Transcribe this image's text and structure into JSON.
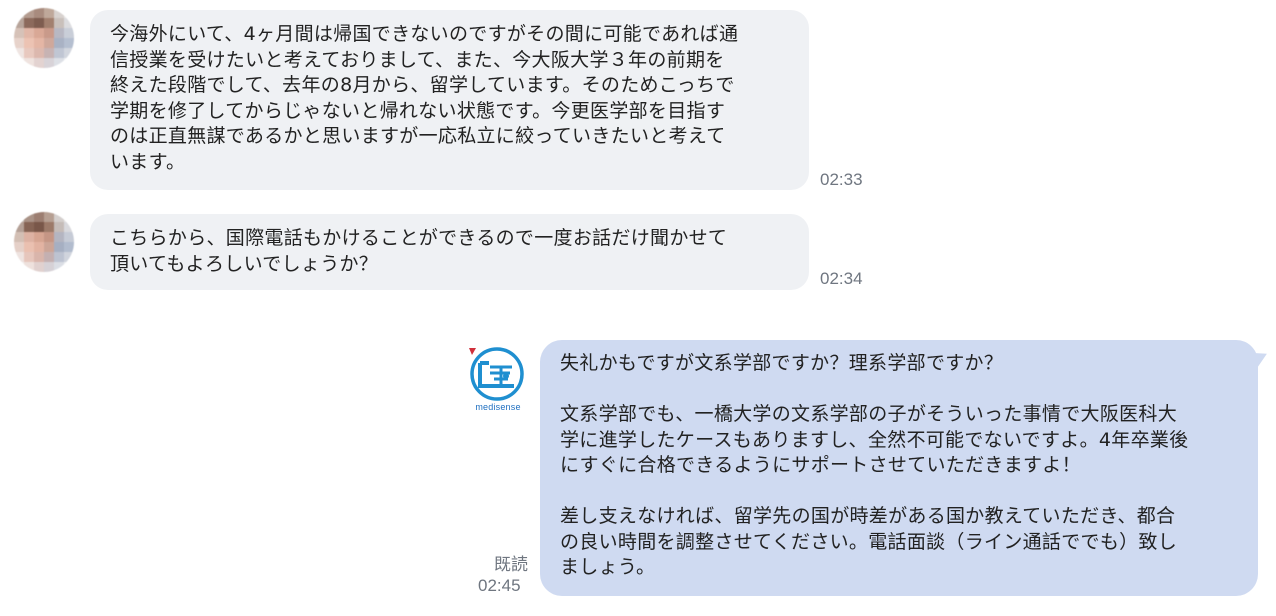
{
  "messages": [
    {
      "id": 1,
      "side": "incoming",
      "lines": [
        "今海外にいて、4ヶ月間は帰国できないのですがその間に可能であれば通",
        "信授業を受けたいと考えておりまして、また、今大阪大学３年の前期を",
        "終えた段階でして、去年の8月から、留学しています。そのためこっちで",
        "学期を修了してからじゃないと帰れない状態です。今更医学部を目指す",
        "のは正直無謀であるかと思いますが一応私立に絞っていきたいと考えて",
        "います。"
      ],
      "time": "02:33"
    },
    {
      "id": 2,
      "side": "incoming",
      "lines": [
        "こちらから、国際電話もかけることができるので一度お話だけ聞かせて",
        "頂いてもよろしいでしょうか？"
      ],
      "time": "02:34"
    },
    {
      "id": 3,
      "side": "outgoing",
      "lines": [
        "失礼かもですが文系学部ですか？理系学部ですか？",
        "",
        "文系学部でも、一橋大学の文系学部の子がそういった事情で大阪医科大",
        "学に進学したケースもありますし、全然不可能でないですよ。4年卒業後",
        "にすぐに合格できるようにサポートさせていただきますよ！",
        "",
        "差し支えなければ、留学先の国が時差がある国か教えていただき、都合",
        "の良い時間を調整させてください。電話面談（ライン通話ででも）致し",
        "ましょう。"
      ],
      "read_label": "既読",
      "time": "02:45"
    }
  ],
  "sender_logo": {
    "text": "medisense",
    "icon": "medisense-logo-icon"
  },
  "colors": {
    "incoming_bubble": "#eff1f4",
    "outgoing_bubble": "#cfdaf1",
    "timestamp": "#6f7680",
    "logo_blue": "#1f8fd0",
    "logo_red": "#d0303b"
  }
}
